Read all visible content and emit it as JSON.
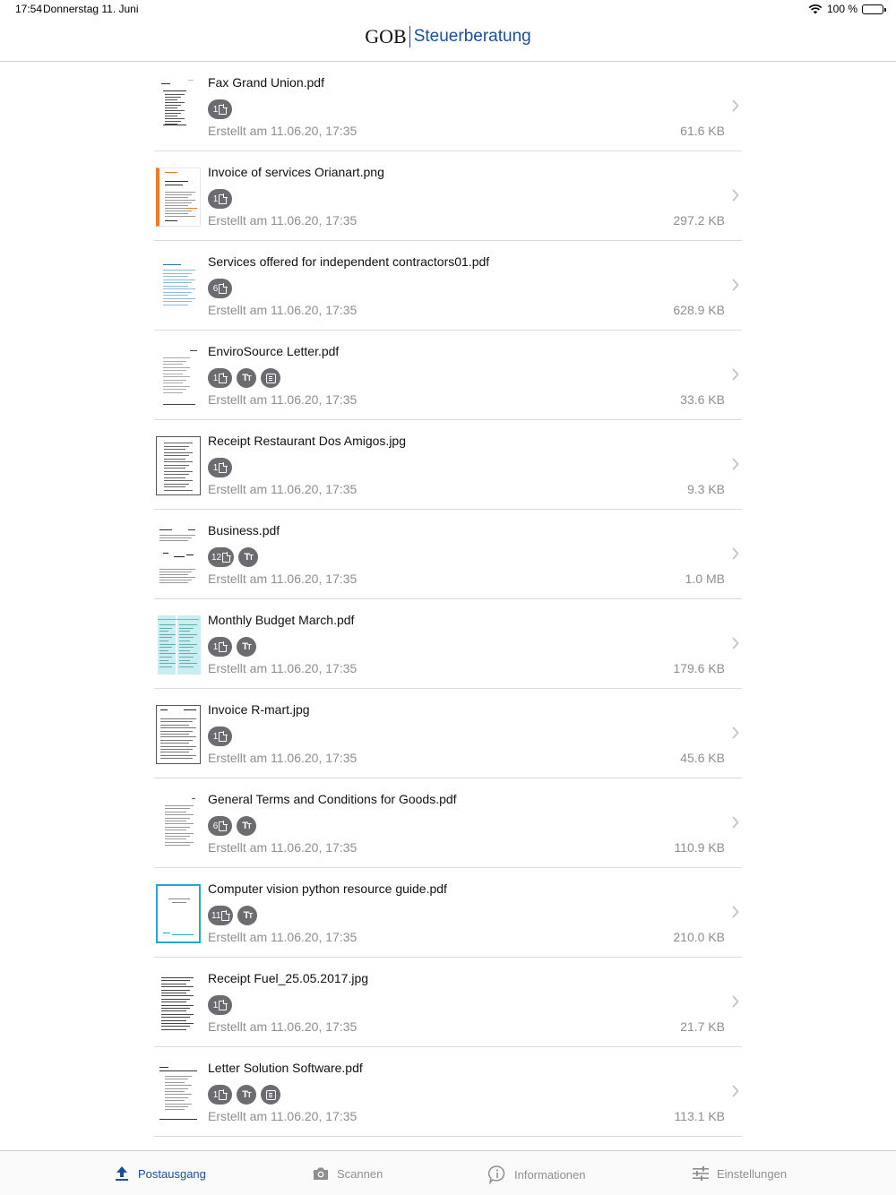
{
  "status_bar": {
    "time": "17:54",
    "date": "Donnerstag 11. Juni",
    "battery": "100 %"
  },
  "header": {
    "logo_left": "GOB",
    "logo_right": "Steuerberatung"
  },
  "colors": {
    "brand_blue": "#1a4f9c",
    "badge_gray": "#6c6c70",
    "secondary_text": "#8e8e93",
    "separator": "#dcdce0"
  },
  "files": [
    {
      "name": "Fax Grand Union.pdf",
      "pages": "1",
      "text_badge": false,
      "ocr_badge": false,
      "created": "Erstellt am 11.06.20, 17:35",
      "size": "61.6 KB",
      "thumb": "fax"
    },
    {
      "name": "Invoice of services Orianart.png",
      "pages": "1",
      "text_badge": false,
      "ocr_badge": false,
      "created": "Erstellt am 11.06.20, 17:35",
      "size": "297.2 KB",
      "thumb": "orange"
    },
    {
      "name": "Services offered for independent contractors01.pdf",
      "pages": "6",
      "text_badge": false,
      "ocr_badge": false,
      "created": "Erstellt am 11.06.20, 17:35",
      "size": "628.9 KB",
      "thumb": "blue-doc"
    },
    {
      "name": "EnviroSource Letter.pdf",
      "pages": "1",
      "text_badge": true,
      "ocr_badge": true,
      "created": "Erstellt am 11.06.20, 17:35",
      "size": "33.6 KB",
      "thumb": "letter"
    },
    {
      "name": "Receipt Restaurant Dos Amigos.jpg",
      "pages": "1",
      "text_badge": false,
      "ocr_badge": false,
      "created": "Erstellt am 11.06.20, 17:35",
      "size": "9.3 KB",
      "thumb": "receipt-box"
    },
    {
      "name": "Business.pdf",
      "pages": "12",
      "text_badge": true,
      "ocr_badge": false,
      "created": "Erstellt am 11.06.20, 17:35",
      "size": "1.0 MB",
      "thumb": "business"
    },
    {
      "name": "Monthly Budget March.pdf",
      "pages": "1",
      "text_badge": true,
      "ocr_badge": false,
      "created": "Erstellt am 11.06.20, 17:35",
      "size": "179.6 KB",
      "thumb": "budget"
    },
    {
      "name": "Invoice R-mart.jpg",
      "pages": "1",
      "text_badge": false,
      "ocr_badge": false,
      "created": "Erstellt am 11.06.20, 17:35",
      "size": "45.6 KB",
      "thumb": "invoice-box"
    },
    {
      "name": "General Terms and Conditions for Goods.pdf",
      "pages": "6",
      "text_badge": true,
      "ocr_badge": false,
      "created": "Erstellt am 11.06.20, 17:35",
      "size": "110.9 KB",
      "thumb": "terms"
    },
    {
      "name": "Computer vision python resource guide.pdf",
      "pages": "11",
      "text_badge": true,
      "ocr_badge": false,
      "created": "Erstellt am 11.06.20, 17:35",
      "size": "210.0 KB",
      "thumb": "cyan"
    },
    {
      "name": "Receipt Fuel_25.05.2017.jpg",
      "pages": "1",
      "text_badge": false,
      "ocr_badge": false,
      "created": "Erstellt am 11.06.20, 17:35",
      "size": "21.7 KB",
      "thumb": "fuel"
    },
    {
      "name": "Letter Solution Software.pdf",
      "pages": "1",
      "text_badge": true,
      "ocr_badge": true,
      "created": "Erstellt am 11.06.20, 17:35",
      "size": "113.1 KB",
      "thumb": "letter2"
    }
  ],
  "tabs": [
    {
      "label": "Postausgang",
      "icon": "upload-icon",
      "active": true
    },
    {
      "label": "Scannen",
      "icon": "camera-icon",
      "active": false
    },
    {
      "label": "Informationen",
      "icon": "info-icon",
      "active": false
    },
    {
      "label": "Einstellungen",
      "icon": "sliders-icon",
      "active": false
    }
  ]
}
